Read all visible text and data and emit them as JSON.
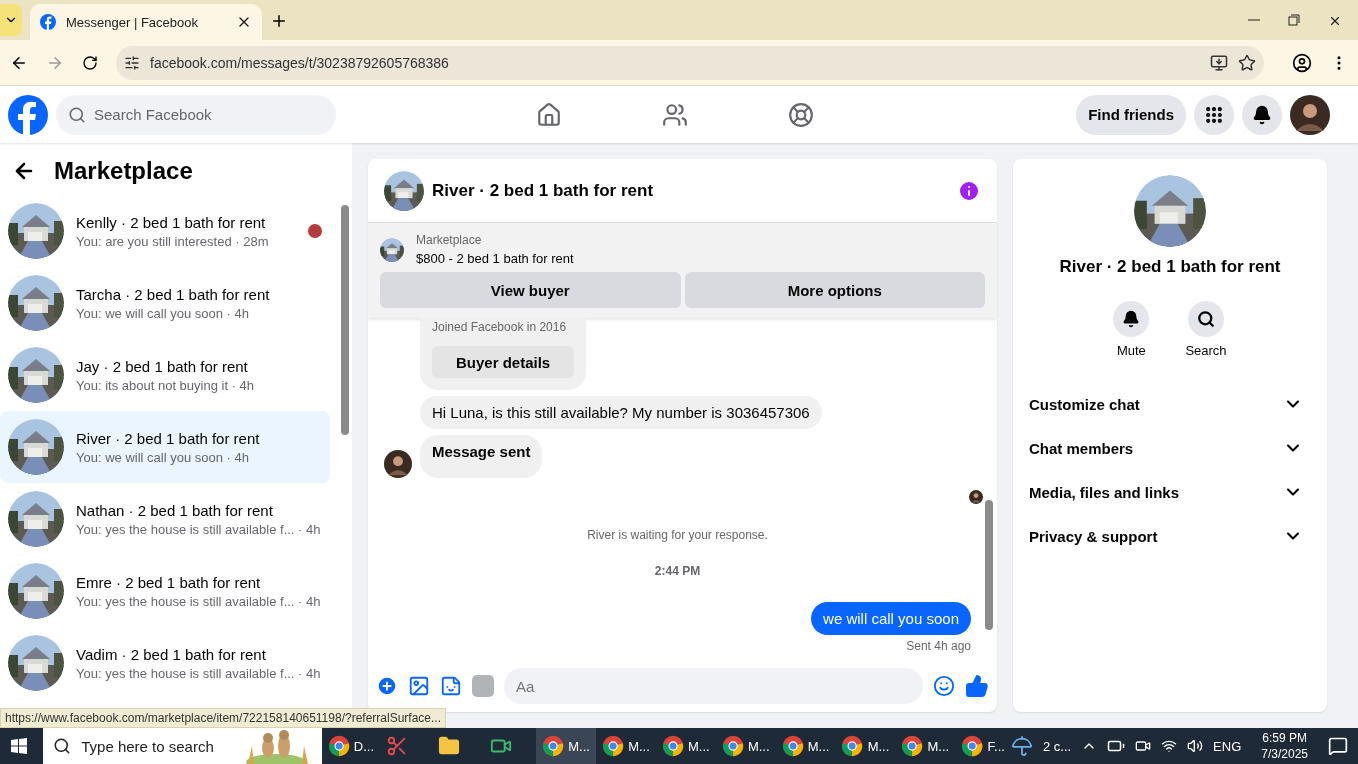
{
  "browser": {
    "tab_title": "Messenger | Facebook",
    "url": "facebook.com/messages/t/30238792605768386",
    "status_url": "https://www.facebook.com/marketplace/item/722158140651198/?referralSurface..."
  },
  "header": {
    "search_placeholder": "Search Facebook",
    "find_friends": "Find friends"
  },
  "sidebar": {
    "title": "Marketplace",
    "conversations": [
      {
        "name": "Kenlly · 2 bed 1 bath for rent",
        "preview": "You: are you still interested",
        "time": "· 28m",
        "selected": false,
        "unread": true
      },
      {
        "name": "Tarcha · 2 bed 1 bath for rent",
        "preview": "You: we will call you soon",
        "time": "· 4h",
        "selected": false,
        "unread": false
      },
      {
        "name": "Jay · 2 bed 1 bath for rent",
        "preview": "You: its about not buying it",
        "time": "· 4h",
        "selected": false,
        "unread": false
      },
      {
        "name": "River · 2 bed 1 bath for rent",
        "preview": "You: we will call you soon",
        "time": "· 4h",
        "selected": true,
        "unread": false
      },
      {
        "name": "Nathan · 2 bed 1 bath for rent",
        "preview": "You: yes the house is still available f...",
        "time": "· 4h",
        "selected": false,
        "unread": false
      },
      {
        "name": "Emre · 2 bed 1 bath for rent",
        "preview": "You: yes the house is still available f...",
        "time": "· 4h",
        "selected": false,
        "unread": false
      },
      {
        "name": "Vadim · 2 bed 1 bath for rent",
        "preview": "You: yes the house is still available f...",
        "time": "· 4h",
        "selected": false,
        "unread": false
      }
    ]
  },
  "chat": {
    "title": "River · 2 bed 1 bath for rent",
    "listing": {
      "label": "Marketplace",
      "title": "$800 - 2 bed 1 bath for rent"
    },
    "buttons": [
      "View buyer",
      "More options"
    ],
    "messages": [
      {
        "kind": "card",
        "text": "Joined Facebook in 2016",
        "button": "Buyer details"
      },
      {
        "kind": "incoming",
        "text": "Hi Luna, is this still available? My number is 3036457306"
      },
      {
        "kind": "incoming",
        "text": "Message sent",
        "avatar": true
      },
      {
        "kind": "seen"
      },
      {
        "kind": "notice",
        "text": "River is waiting for your response."
      },
      {
        "kind": "time",
        "text": "2:44 PM"
      },
      {
        "kind": "outgoing",
        "text": "we will call you soon",
        "status": "Sent 4h ago"
      }
    ],
    "composer_placeholder": "Aa"
  },
  "details": {
    "title": "River · 2 bed 1 bath for rent",
    "actions": [
      {
        "kind": "mute",
        "label": "Mute"
      },
      {
        "kind": "search",
        "label": "Search"
      }
    ],
    "sections": [
      "Customize chat",
      "Chat members",
      "Media, files and links",
      "Privacy & support"
    ]
  },
  "taskbar": {
    "search_placeholder": "Type here to search",
    "apps": [
      {
        "kind": "chrome",
        "label": "D...",
        "active": false
      },
      {
        "kind": "snip",
        "active": false
      },
      {
        "kind": "folder",
        "active": false
      },
      {
        "kind": "video",
        "active": false
      },
      {
        "kind": "chrome",
        "label": "M...",
        "active": true
      },
      {
        "kind": "chrome",
        "label": "M...",
        "active": false
      },
      {
        "kind": "chrome",
        "label": "M...",
        "active": false
      },
      {
        "kind": "chrome",
        "label": "M...",
        "active": false
      },
      {
        "kind": "chrome",
        "label": "M...",
        "active": false
      },
      {
        "kind": "chrome",
        "label": "M...",
        "active": false
      },
      {
        "kind": "chrome",
        "label": "M...",
        "active": false
      },
      {
        "kind": "chrome",
        "label": "F...",
        "active": false
      }
    ],
    "weather": "2 c...",
    "language": "ENG",
    "time": "6:59 PM",
    "date": "7/3/2025"
  }
}
